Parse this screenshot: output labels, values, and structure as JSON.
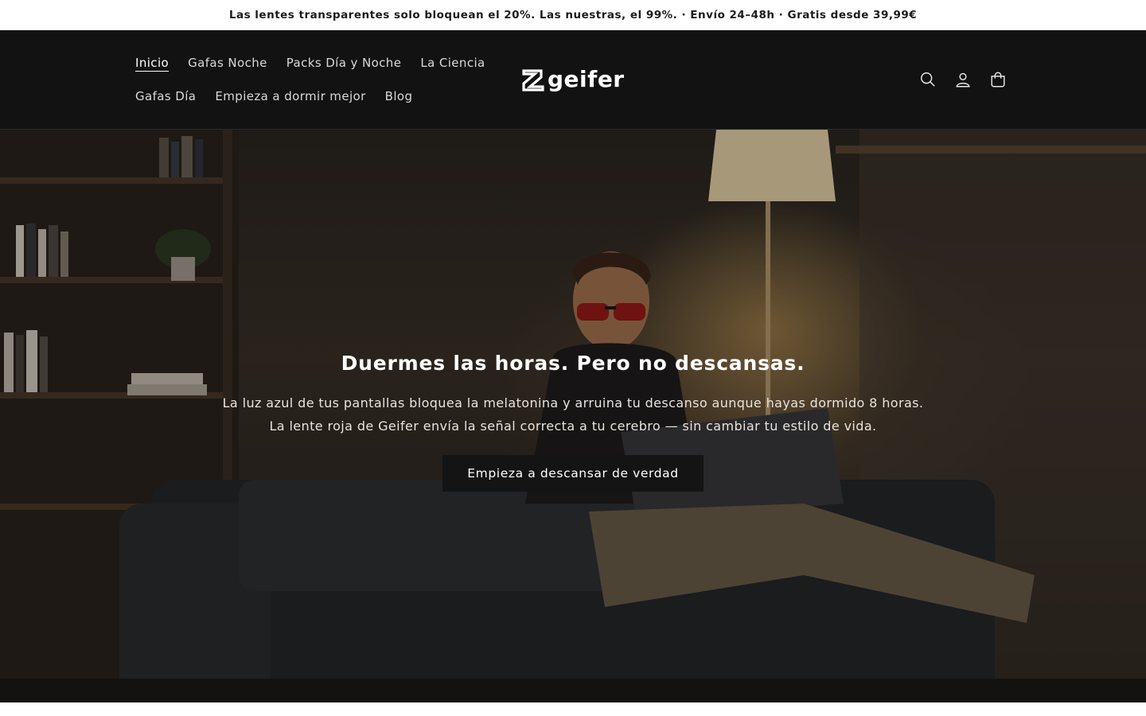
{
  "announcement": {
    "text": "Las lentes transparentes solo bloquean el 20%. Las nuestras, el 99%. · Envío 24–48h · Gratis desde 39,99€"
  },
  "header": {
    "nav_row1": [
      {
        "label": "Inicio",
        "active": true
      },
      {
        "label": "Gafas Noche"
      },
      {
        "label": "Packs Día y Noche"
      },
      {
        "label": "La Ciencia"
      }
    ],
    "nav_row2": [
      {
        "label": "Gafas Día"
      },
      {
        "label": "Empieza a dormir mejor"
      },
      {
        "label": "Blog"
      }
    ],
    "logo_text": "geifer",
    "icons": [
      "search-icon",
      "account-icon",
      "cart-icon"
    ]
  },
  "hero": {
    "title": "Duermes las horas. Pero no descansas.",
    "text_line1": "La luz azul de tus pantallas bloquea la melatonina y arruina tu descanso aunque hayas dormido 8 horas.",
    "text_line2": "La lente roja de Geifer envía la señal correcta a tu cerebro — sin cambiar tu estilo de vida.",
    "cta_label": "Empieza a descansar de verdad"
  },
  "colors": {
    "header_bg": "#121212",
    "announce_bg": "#ffffff",
    "cta_bg": "#141414",
    "text_light": "#ffffff"
  }
}
